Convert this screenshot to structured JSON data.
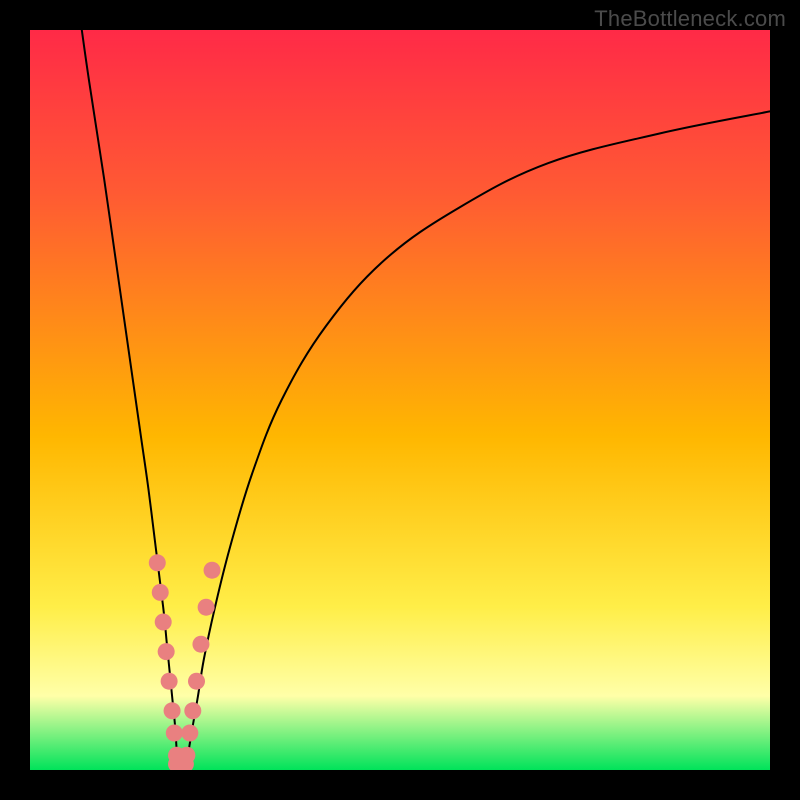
{
  "watermark": "TheBottleneck.com",
  "colors": {
    "frame": "#000000",
    "gradient_top": "#ff2a47",
    "gradient_upper": "#ff5a33",
    "gradient_mid": "#ffb700",
    "gradient_low": "#ffee48",
    "gradient_pale": "#ffffa8",
    "gradient_bottom": "#00e35a",
    "curve": "#000000",
    "marker": "#e98080"
  },
  "chart_data": {
    "type": "line",
    "title": "",
    "xlabel": "",
    "ylabel": "",
    "xlim": [
      0,
      100
    ],
    "ylim": [
      0,
      100
    ],
    "series": [
      {
        "name": "left-branch",
        "x": [
          7,
          8,
          10,
          12,
          14,
          15,
          16,
          17,
          18,
          18.5,
          19,
          19.3,
          19.6,
          19.8,
          20
        ],
        "y": [
          100,
          93,
          80,
          66,
          52,
          45,
          38,
          30,
          22,
          17,
          12,
          9,
          6,
          3,
          0
        ]
      },
      {
        "name": "right-branch",
        "x": [
          21,
          21.5,
          22,
          22.7,
          23.5,
          25,
          27,
          30,
          34,
          40,
          48,
          58,
          70,
          85,
          100
        ],
        "y": [
          0,
          3,
          6,
          10,
          15,
          22,
          30,
          40,
          50,
          60,
          69,
          76,
          82,
          86,
          89
        ]
      }
    ],
    "markers": [
      {
        "name": "left-cluster",
        "x": [
          17.2,
          17.6,
          18.0,
          18.4,
          18.8,
          19.2,
          19.5,
          19.8
        ],
        "y": [
          28,
          24,
          20,
          16,
          12,
          8,
          5,
          2
        ]
      },
      {
        "name": "right-cluster",
        "x": [
          21.2,
          21.6,
          22.0,
          22.5,
          23.1,
          23.8,
          24.6
        ],
        "y": [
          2,
          5,
          8,
          12,
          17,
          22,
          27
        ]
      },
      {
        "name": "base-cluster",
        "x": [
          19.8,
          20.2,
          20.6,
          21.0
        ],
        "y": [
          0.8,
          0.5,
          0.5,
          0.8
        ]
      }
    ],
    "optimum_x": 20.5
  }
}
